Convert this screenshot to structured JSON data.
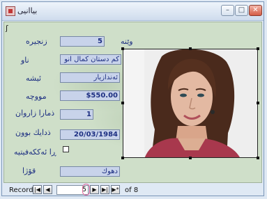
{
  "window": {
    "title": "بیاانیی",
    "buttons": [
      "–",
      "□",
      "✕"
    ]
  },
  "form": {
    "fields": [
      {
        "label": "زنجیره",
        "value": "5"
      },
      {
        "label": "ناو",
        "value": "کم دستان کمال انو"
      },
      {
        "label": "ئیشه",
        "value": "ئەندازیار"
      },
      {
        "label": "مووچە",
        "value": "$550.00"
      },
      {
        "label": "ذمارا زاروان",
        "value": "1"
      },
      {
        "label": "ذدایك بوون",
        "value": "20/03/1984"
      },
      {
        "label": "ڕا ئەککەفیتیە",
        "value": ""
      },
      {
        "label": "قۆژا",
        "value": "دهوك"
      }
    ],
    "photo_label": "وێنە"
  },
  "navigation": {
    "label": "Record:",
    "current": "5",
    "total_text": "of 8",
    "buttons": [
      "first",
      "previous",
      "next",
      "last",
      "new"
    ]
  }
}
